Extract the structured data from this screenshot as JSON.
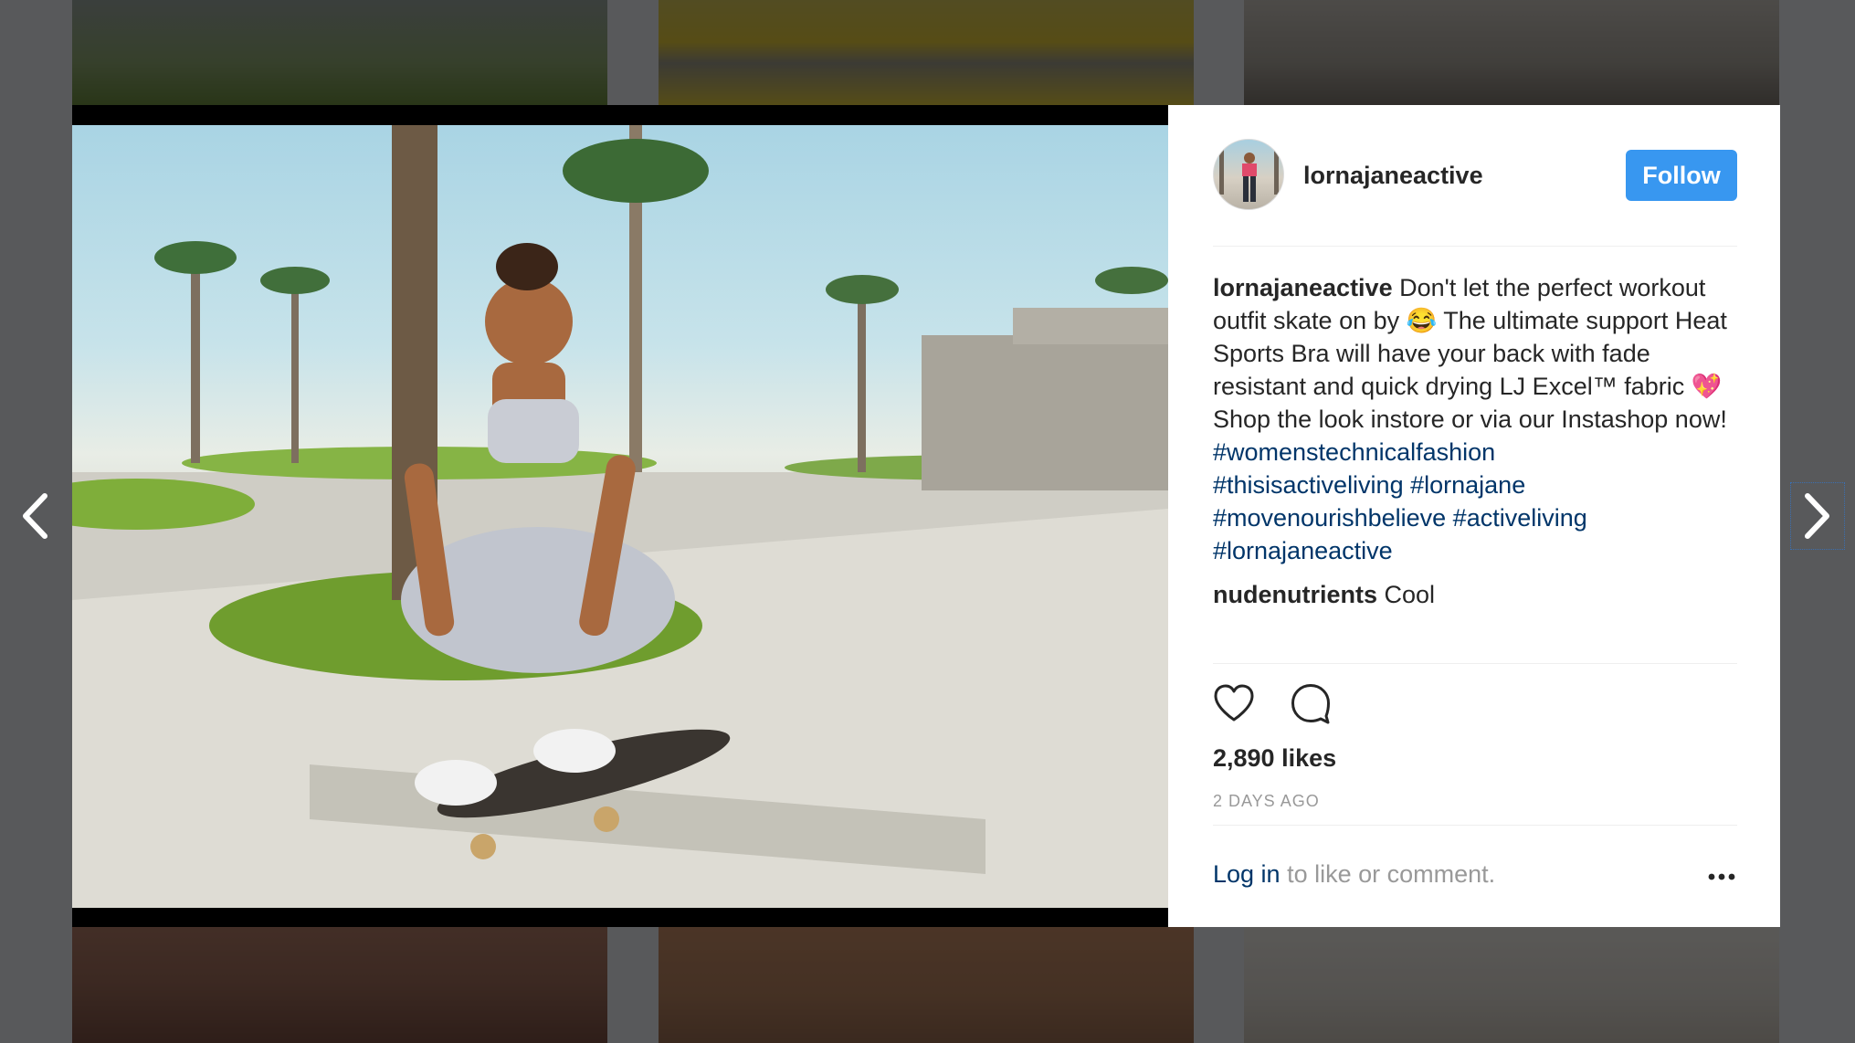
{
  "post": {
    "username": "lornajaneactive",
    "follow_label": "Follow",
    "caption": {
      "user": "lornajaneactive",
      "text_1": " Don't let the perfect workout outfit skate on by ",
      "emoji_1": "😂",
      "text_2": " The ultimate support Heat Sports Bra will have your back with fade resistant and quick drying LJ Excel™ fabric ",
      "emoji_2": "💖",
      "text_3": " Shop the look instore or via our Instashop now!",
      "hashtags": [
        "#womenstechnicalfashion",
        "#thisisactiveliving",
        "#lornajane",
        "#movenourishbelieve",
        "#activeliving",
        "#lornajaneactive"
      ]
    },
    "comments": [
      {
        "user": "nudenutrients",
        "text": " Cool"
      }
    ],
    "likes": "2,890 likes",
    "timestamp": "2 DAYS AGO",
    "login_link": "Log in",
    "login_suffix": " to like or comment."
  },
  "icons": {
    "prev": "chevron-left-icon",
    "next": "chevron-right-icon",
    "like": "heart-icon",
    "comment": "comment-bubble-icon",
    "more": "more-options-icon"
  },
  "colors": {
    "follow_button": "#3897f0",
    "hashtag": "#003569",
    "text": "#262626",
    "muted": "#999999",
    "overlay": "#58595b"
  }
}
